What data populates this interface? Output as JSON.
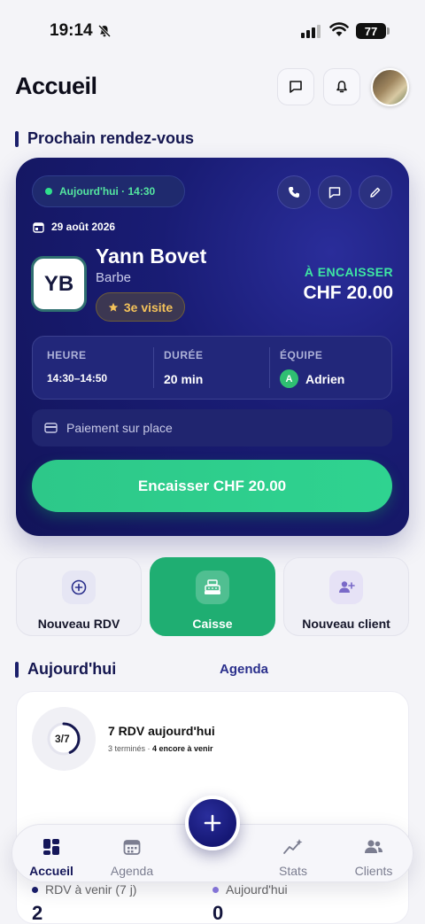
{
  "status_bar": {
    "time": "19:14",
    "battery": "77"
  },
  "header": {
    "title": "Accueil"
  },
  "next_appointment": {
    "section_title": "Prochain rendez-vous",
    "today_label": "Aujourd'hui · 14:30",
    "date": "29 août 2026",
    "initials": "YB",
    "client_name": "Yann Bovet",
    "service": "Barbe",
    "visit_badge": "3e visite",
    "due_label": "À ENCAISSER",
    "due_amount": "CHF 20.00",
    "time_label": "HEURE",
    "time_value": "14:30–14:50",
    "duration_label": "DURÉE",
    "duration_value": "20 min",
    "team_label": "ÉQUIPE",
    "team_initial": "A",
    "team_value": "Adrien",
    "payment": "Paiement sur place",
    "cash_button": "Encaisser  CHF 20.00"
  },
  "quick_actions": [
    {
      "label": "Nouveau RDV",
      "icon": "plus-circle-icon"
    },
    {
      "label": "Caisse",
      "icon": "cash-register-icon"
    },
    {
      "label": "Nouveau client",
      "icon": "user-plus-icon"
    }
  ],
  "today": {
    "section_title": "Aujourd'hui",
    "agenda_link": "Agenda",
    "ring_label": "3/7",
    "ring_progress": 0.43,
    "rdv_title": "7 RDV aujourd'hui",
    "rdv_done": "3 terminés · ",
    "rdv_upcoming": "4 encore à venir",
    "stat_left_label": "RDV à venir (7 j)",
    "stat_left_value": "2",
    "stat_right_label": "Aujourd'hui",
    "stat_right_value": "0"
  },
  "nav": {
    "items": [
      {
        "label": "Accueil",
        "icon": "dashboard-icon",
        "active": true
      },
      {
        "label": "Agenda",
        "icon": "calendar-icon",
        "active": false
      },
      {
        "label": "Stats",
        "icon": "trend-icon",
        "active": false
      },
      {
        "label": "Clients",
        "icon": "users-icon",
        "active": false
      }
    ],
    "fab_icon": "plus-icon"
  },
  "colors": {
    "primary": "#151774",
    "accent_green": "#2fd390",
    "gold": "#f4c25a"
  }
}
